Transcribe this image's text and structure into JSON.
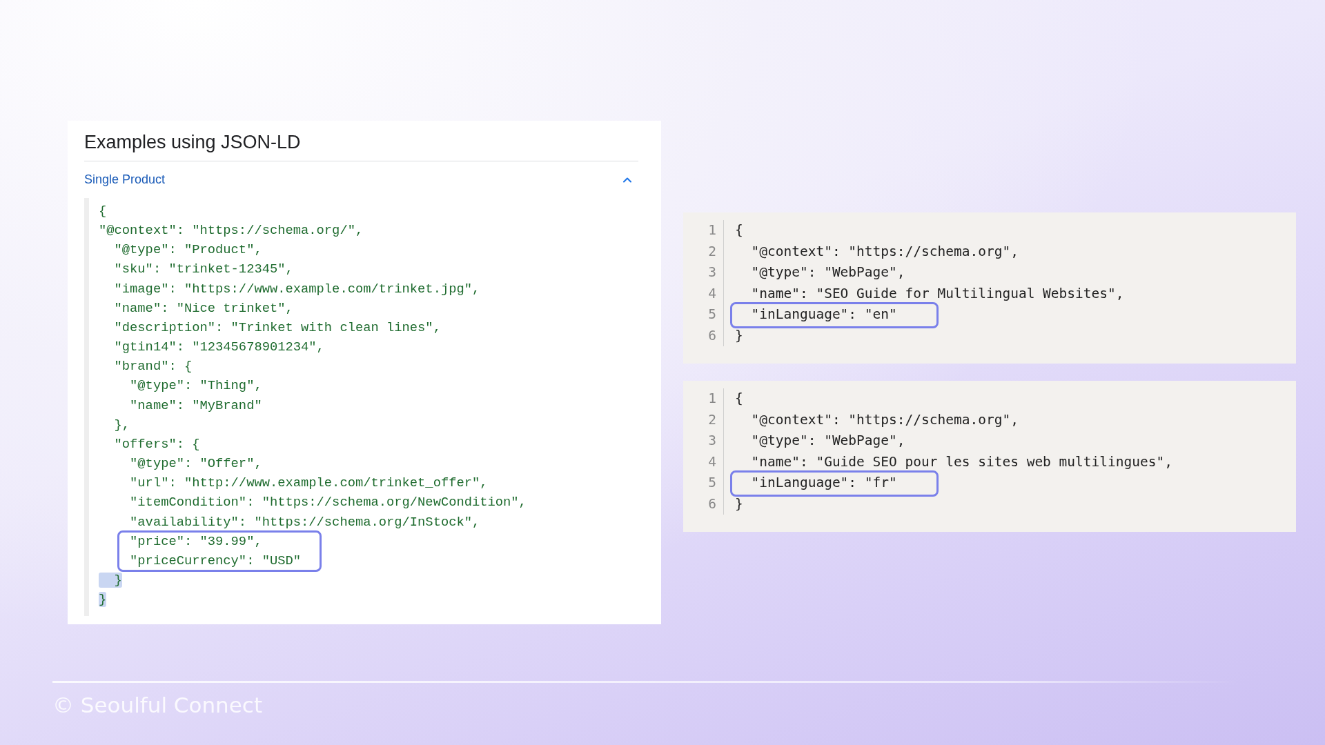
{
  "left_panel": {
    "heading": "Examples using JSON-LD",
    "accordion": {
      "title": "Single Product",
      "expanded": true
    },
    "code_lines": [
      {
        "text": "{",
        "highlighted": false,
        "text_selected": false
      },
      {
        "text": "\"@context\": \"https://schema.org/\",",
        "highlighted": false,
        "text_selected": false
      },
      {
        "text": "  \"@type\": \"Product\",",
        "highlighted": false,
        "text_selected": false
      },
      {
        "text": "  \"sku\": \"trinket-12345\",",
        "highlighted": false,
        "text_selected": false
      },
      {
        "text": "  \"image\": \"https://www.example.com/trinket.jpg\",",
        "highlighted": false,
        "text_selected": false
      },
      {
        "text": "  \"name\": \"Nice trinket\",",
        "highlighted": false,
        "text_selected": false
      },
      {
        "text": "  \"description\": \"Trinket with clean lines\",",
        "highlighted": false,
        "text_selected": false
      },
      {
        "text": "  \"gtin14\": \"12345678901234\",",
        "highlighted": false,
        "text_selected": false
      },
      {
        "text": "  \"brand\": {",
        "highlighted": false,
        "text_selected": false
      },
      {
        "text": "    \"@type\": \"Thing\",",
        "highlighted": false,
        "text_selected": false
      },
      {
        "text": "    \"name\": \"MyBrand\"",
        "highlighted": false,
        "text_selected": false
      },
      {
        "text": "  },",
        "highlighted": false,
        "text_selected": false
      },
      {
        "text": "  \"offers\": {",
        "highlighted": false,
        "text_selected": false
      },
      {
        "text": "    \"@type\": \"Offer\",",
        "highlighted": false,
        "text_selected": false
      },
      {
        "text": "    \"url\": \"http://www.example.com/trinket_offer\",",
        "highlighted": false,
        "text_selected": false
      },
      {
        "text": "    \"itemCondition\": \"https://schema.org/NewCondition\",",
        "highlighted": false,
        "text_selected": false
      },
      {
        "text": "    \"availability\": \"https://schema.org/InStock\",",
        "highlighted": false,
        "text_selected": false
      },
      {
        "text": "    \"price\": \"39.99\",",
        "highlighted": true,
        "text_selected": false
      },
      {
        "text": "    \"priceCurrency\": \"USD\"",
        "highlighted": true,
        "text_selected": false
      },
      {
        "text": "  }",
        "highlighted": false,
        "text_selected": true
      },
      {
        "text": "}",
        "highlighted": false,
        "text_selected": true
      }
    ]
  },
  "right_panels": [
    {
      "lines": [
        {
          "number": "1",
          "text": "{",
          "highlighted": false
        },
        {
          "number": "2",
          "text": "  \"@context\": \"https://schema.org\",",
          "highlighted": false
        },
        {
          "number": "3",
          "text": "  \"@type\": \"WebPage\",",
          "highlighted": false
        },
        {
          "number": "4",
          "text": "  \"name\": \"SEO Guide for Multilingual Websites\",",
          "highlighted": false
        },
        {
          "number": "5",
          "text": "  \"inLanguage\": \"en\"",
          "highlighted": true
        },
        {
          "number": "6",
          "text": "}",
          "highlighted": false
        }
      ]
    },
    {
      "lines": [
        {
          "number": "1",
          "text": "{",
          "highlighted": false
        },
        {
          "number": "2",
          "text": "  \"@context\": \"https://schema.org\",",
          "highlighted": false
        },
        {
          "number": "3",
          "text": "  \"@type\": \"WebPage\",",
          "highlighted": false
        },
        {
          "number": "4",
          "text": "  \"name\": \"Guide SEO pour les sites web multilingues\",",
          "highlighted": false
        },
        {
          "number": "5",
          "text": "  \"inLanguage\": \"fr\"",
          "highlighted": true
        },
        {
          "number": "6",
          "text": "}",
          "highlighted": false
        }
      ]
    }
  ],
  "footer": {
    "copyright": "© Seoulful Connect"
  }
}
